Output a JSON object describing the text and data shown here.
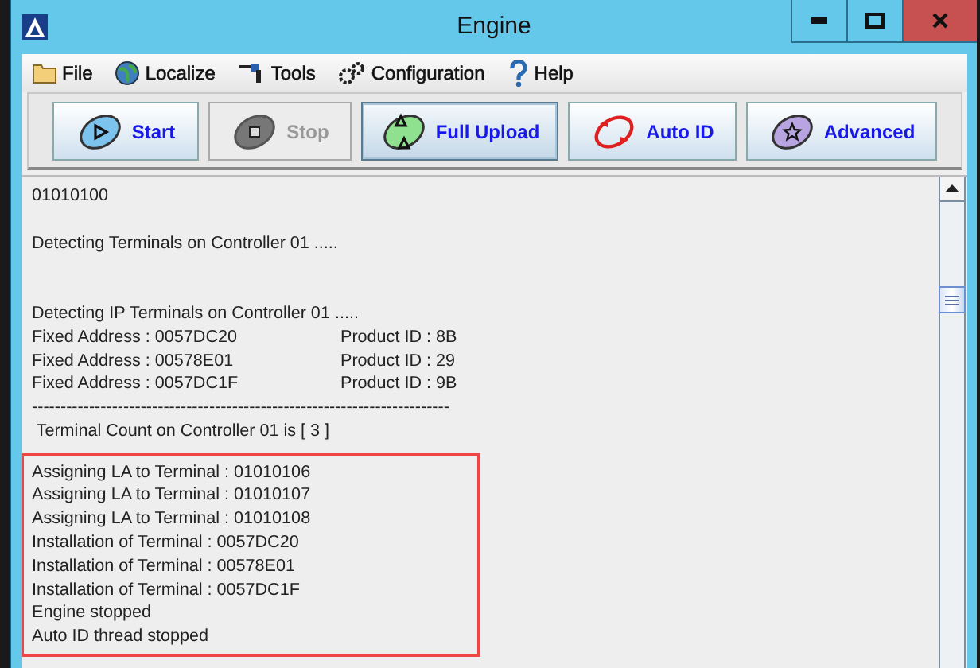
{
  "window": {
    "title": "Engine"
  },
  "menu": [
    {
      "label": "File"
    },
    {
      "label": "Localize"
    },
    {
      "label": "Tools"
    },
    {
      "label": "Configuration"
    },
    {
      "label": "Help"
    }
  ],
  "toolbar": [
    {
      "label": "Start",
      "disabled": false,
      "focused": false
    },
    {
      "label": "Stop",
      "disabled": true,
      "focused": false
    },
    {
      "label": "Full Upload",
      "disabled": false,
      "focused": true
    },
    {
      "label": "Auto ID",
      "disabled": false,
      "focused": false
    },
    {
      "label": "Advanced",
      "disabled": false,
      "focused": false
    }
  ],
  "log": {
    "blocks": [
      {
        "highlighted": false,
        "lines": [
          {
            "kind": "text",
            "text": "01010100"
          },
          {
            "kind": "spacer"
          },
          {
            "kind": "text",
            "text": "Detecting Terminals on Controller 01 ....."
          },
          {
            "kind": "spacer"
          },
          {
            "kind": "spacer"
          },
          {
            "kind": "text",
            "text": "Detecting IP Terminals on Controller 01 ....."
          },
          {
            "kind": "pair",
            "text": "Fixed Address : 0057DC20",
            "column_2": "Product ID : 8B"
          },
          {
            "kind": "pair",
            "text": "Fixed Address : 00578E01",
            "column_2": "Product ID : 29"
          },
          {
            "kind": "pair",
            "text": "Fixed Address : 0057DC1F",
            "column_2": "Product ID : 9B"
          },
          {
            "kind": "text",
            "text": "-------------------------------------------------------------------------"
          },
          {
            "kind": "text",
            "text": " Terminal Count on Controller 01 is [ 3 ]"
          },
          {
            "kind": "spacer"
          }
        ]
      },
      {
        "highlighted": true,
        "lines": [
          {
            "kind": "text",
            "text": "Assigning LA to Terminal : 01010106"
          },
          {
            "kind": "text",
            "text": "Assigning LA to Terminal : 01010107"
          },
          {
            "kind": "text",
            "text": "Assigning LA to Terminal : 01010108"
          },
          {
            "kind": "text",
            "text": "Installation of Terminal : 0057DC20"
          },
          {
            "kind": "text",
            "text": "Installation of Terminal : 00578E01"
          },
          {
            "kind": "text",
            "text": "Installation of Terminal : 0057DC1F"
          },
          {
            "kind": "text",
            "text": "Engine stopped"
          },
          {
            "kind": "text",
            "text": "Auto ID thread stopped"
          }
        ]
      }
    ]
  }
}
